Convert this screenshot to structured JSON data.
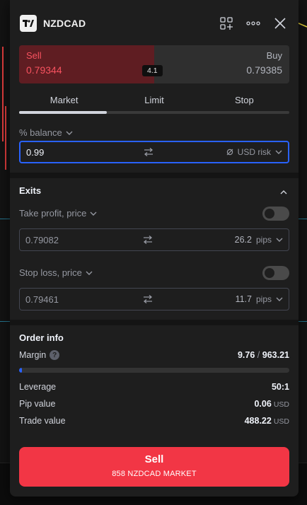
{
  "colors": {
    "sell_red": "#f23645",
    "sell_bg": "#5f1d22",
    "accent_blue": "#2962ff",
    "panel_bg": "#1e1e1e"
  },
  "header": {
    "logo_icon": "tradingview-logo",
    "symbol": "NZDCAD",
    "icons": [
      "add-widget-icon",
      "more-icon",
      "close-icon"
    ]
  },
  "quote": {
    "sell_label": "Sell",
    "sell_price": "0.79344",
    "buy_label": "Buy",
    "buy_price": "0.79385",
    "spread": "4.1"
  },
  "order_tabs": [
    "Market",
    "Limit",
    "Stop"
  ],
  "active_tab": "Market",
  "quantity": {
    "label": "% balance",
    "value": "0.99",
    "unit": "USD risk",
    "unit_icon": "empty-set-icon"
  },
  "exits": {
    "title": "Exits",
    "take_profit": {
      "label": "Take profit, price",
      "value": "0.79082",
      "pips": "26.2",
      "unit": "pips",
      "enabled": false
    },
    "stop_loss": {
      "label": "Stop loss, price",
      "value": "0.79461",
      "pips": "11.7",
      "unit": "pips",
      "enabled": false
    }
  },
  "order_info": {
    "title": "Order info",
    "margin_label": "Margin",
    "margin_used": "9.76",
    "margin_separator": "/",
    "margin_available": "963.21",
    "margin_fraction": 0.01,
    "rows": [
      {
        "label": "Leverage",
        "value": "50:1",
        "currency": ""
      },
      {
        "label": "Pip value",
        "value": "0.06",
        "currency": "USD"
      },
      {
        "label": "Trade value",
        "value": "488.22",
        "currency": "USD"
      }
    ]
  },
  "submit": {
    "label": "Sell",
    "detail": "858 NZDCAD MARKET"
  }
}
